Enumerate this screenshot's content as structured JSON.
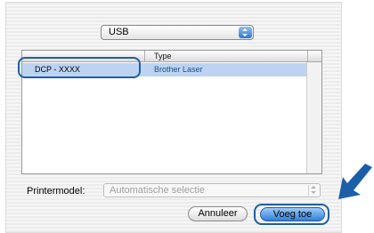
{
  "connection_popup": {
    "value": "USB"
  },
  "printer_list": {
    "columns": [
      "",
      "Type"
    ],
    "rows": [
      {
        "name": "DCP - XXXX",
        "type": "Brother Laser"
      }
    ]
  },
  "printer_model": {
    "label": "Printermodel:",
    "value": "Automatische selectie"
  },
  "buttons": {
    "cancel": "Annuleer",
    "add": "Voeg toe"
  },
  "colors": {
    "accent": "#2f7fd8",
    "highlight_outline": "#1f5fa0",
    "selection": "#bcd4f2"
  }
}
